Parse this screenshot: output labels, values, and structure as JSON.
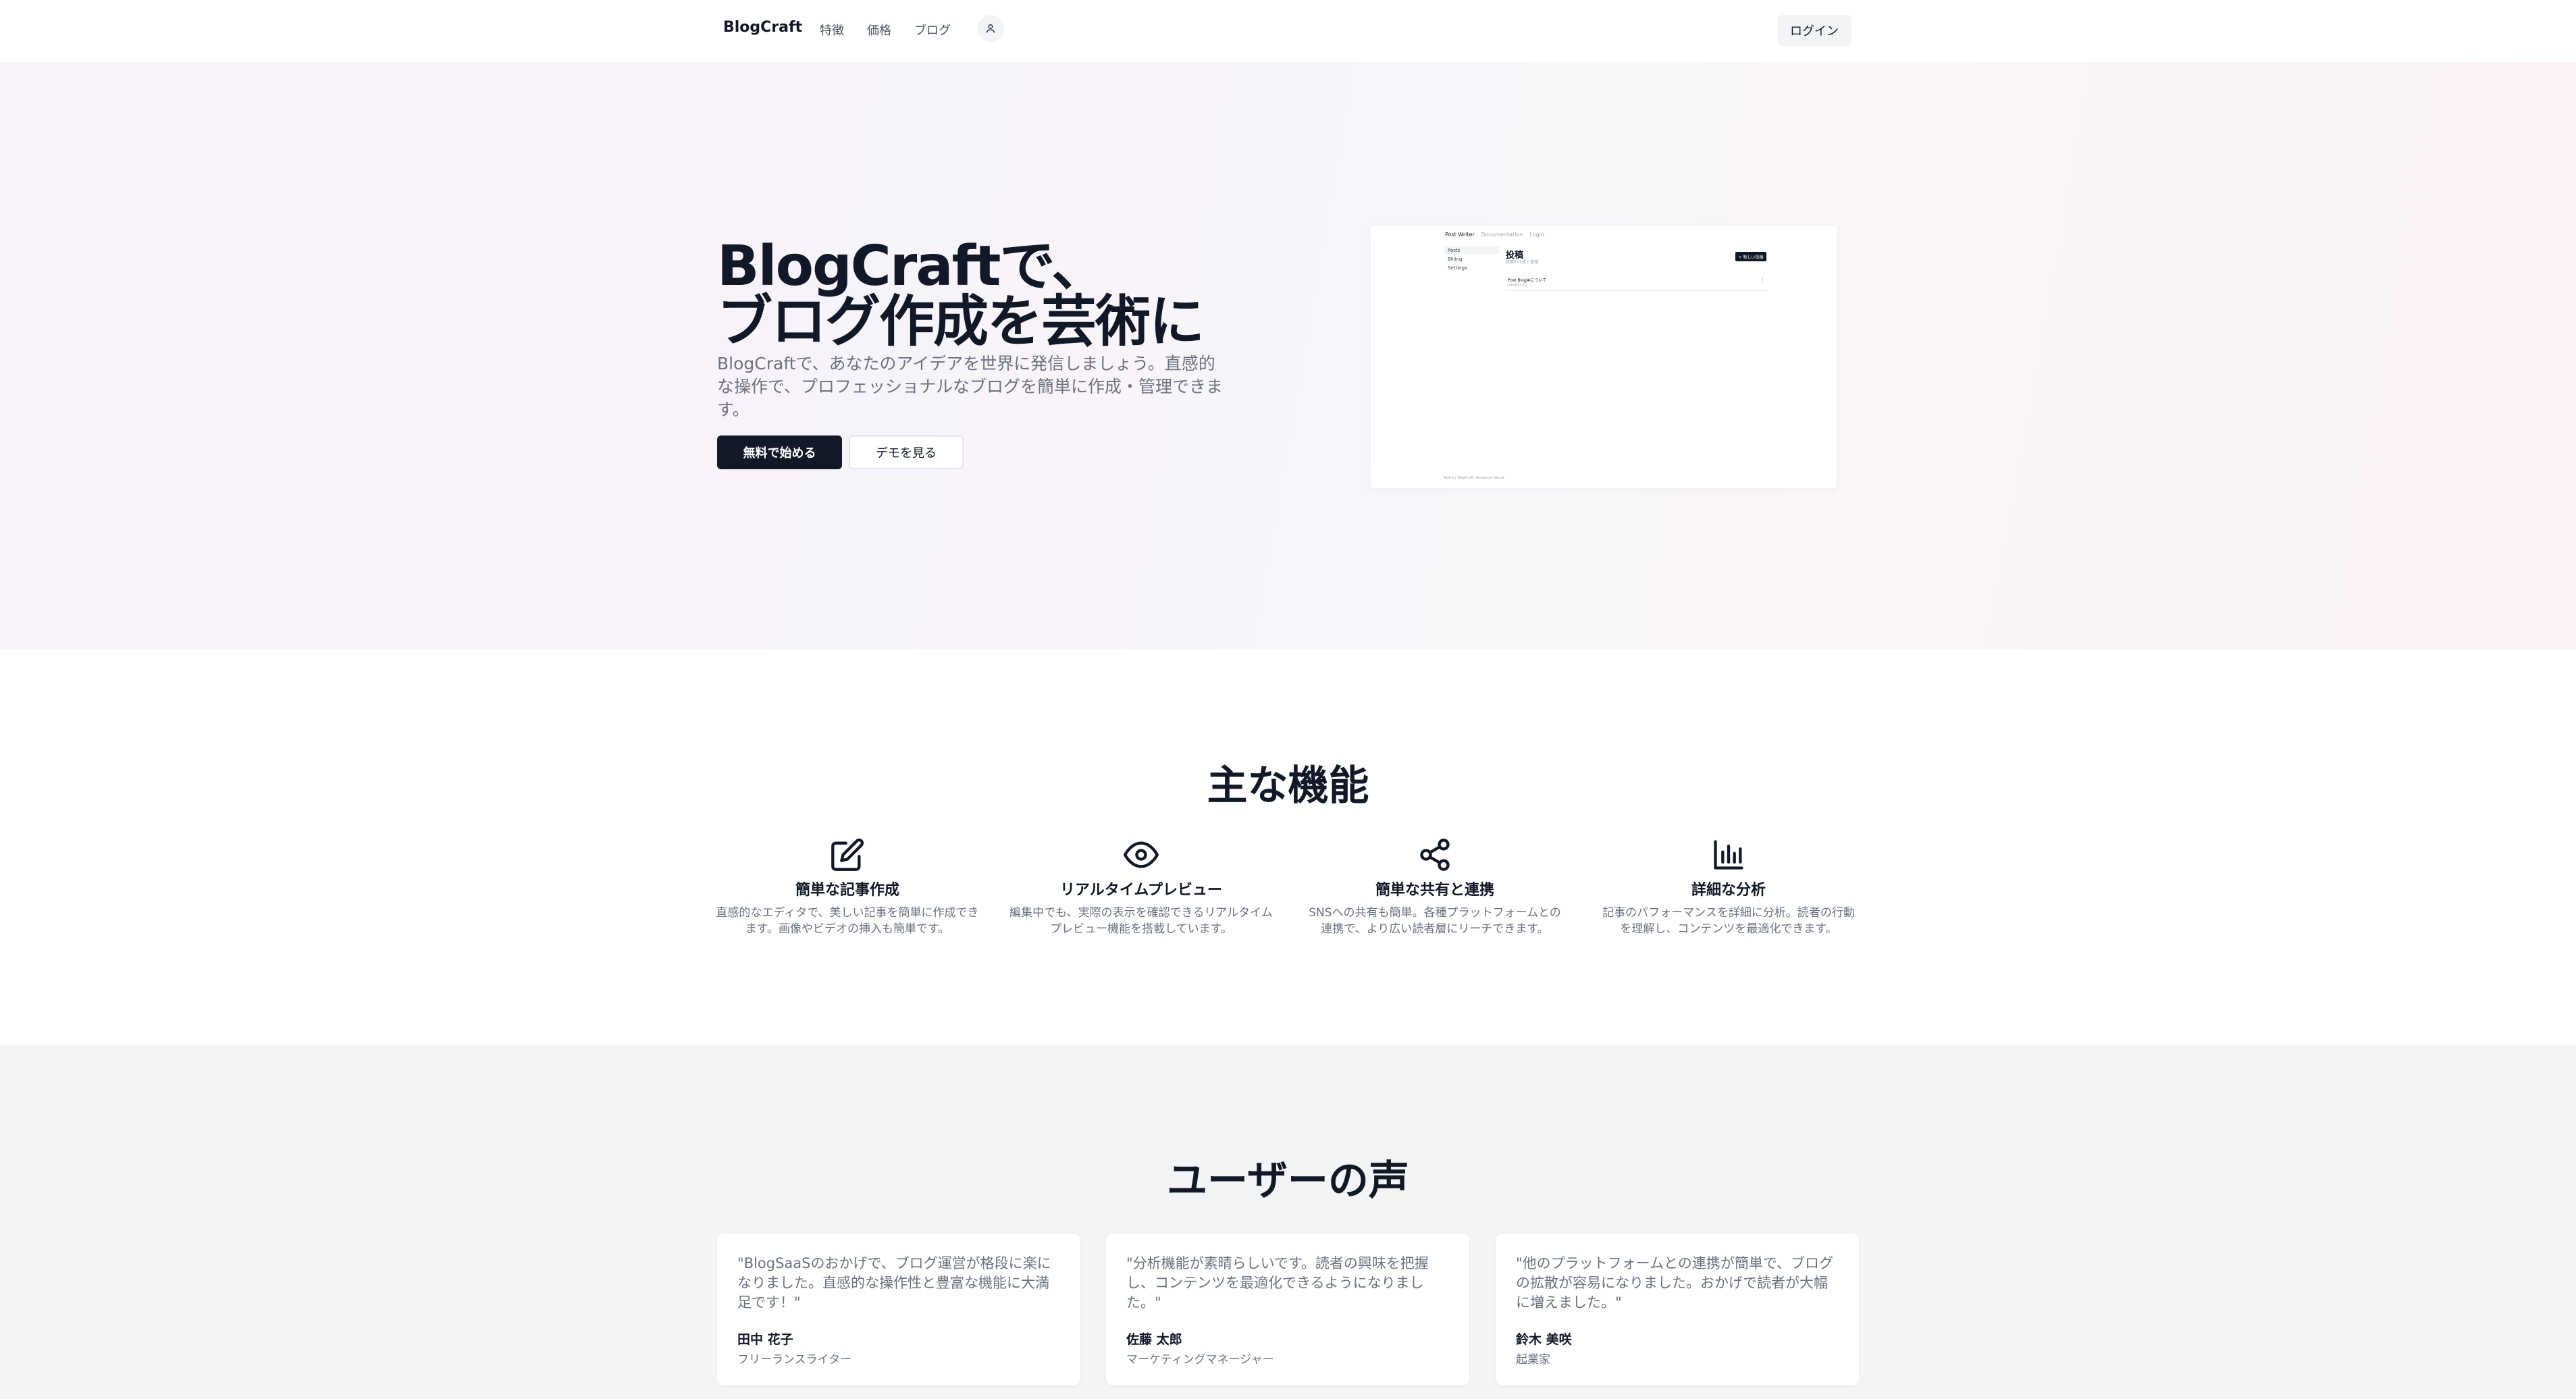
{
  "header": {
    "brand": "BlogCraft",
    "nav": [
      "特徴",
      "価格",
      "ブログ"
    ],
    "login_label": "ログイン"
  },
  "hero": {
    "title_line1": "BlogCraftで、",
    "title_line2": "ブログ作成を芸術に",
    "description": "BlogCraftで、あなたのアイデアを世界に発信しましょう。直感的な操作で、プロフェッショナルなブログを簡単に作成・管理できます。",
    "primary_cta": "無料で始める",
    "secondary_cta": "デモを見る"
  },
  "preview": {
    "top_bar": [
      "Post Writer",
      "Documentation",
      "Login"
    ],
    "side_items": [
      "Posts",
      "Billing",
      "Settings"
    ],
    "title": "投稿",
    "subtitle": "記事の作成と管理",
    "new_button": "+ 新しい投稿",
    "row_title": "Post BlogAIについて",
    "row_date": "2024/01/01",
    "row_menu": "⋮",
    "footer": "Built by BlogCraft. Hosted on Vercel."
  },
  "features": {
    "title": "主な機能",
    "items": [
      {
        "icon": "edit-icon",
        "name": "簡単な記事作成",
        "desc": "直感的なエディタで、美しい記事を簡単に作成できます。画像やビデオの挿入も簡単です。"
      },
      {
        "icon": "eye-icon",
        "name": "リアルタイムプレビュー",
        "desc": "編集中でも、実際の表示を確認できるリアルタイムプレビュー機能を搭載しています。"
      },
      {
        "icon": "share-icon",
        "name": "簡単な共有と連携",
        "desc": "SNSへの共有も簡単。各種プラットフォームとの連携で、より広い読者層にリーチできます。"
      },
      {
        "icon": "bar-chart-icon",
        "name": "詳細な分析",
        "desc": "記事のパフォーマンスを詳細に分析。読者の行動を理解し、コンテンツを最適化できます。"
      }
    ]
  },
  "testimonials": {
    "title": "ユーザーの声",
    "items": [
      {
        "quote": "\"BlogSaaSのおかげで、ブログ運営が格段に楽になりました。直感的な操作性と豊富な機能に大満足です！\"",
        "name": "田中 花子",
        "role": "フリーランスライター"
      },
      {
        "quote": "\"分析機能が素晴らしいです。読者の興味を把握し、コンテンツを最適化できるようになりました。\"",
        "name": "佐藤 太郎",
        "role": "マーケティングマネージャー"
      },
      {
        "quote": "\"他のプラットフォームとの連携が簡単で、ブログの拡散が容易になりました。おかげで読者が大幅に増えました。\"",
        "name": "鈴木 美咲",
        "role": "起業家"
      }
    ]
  }
}
